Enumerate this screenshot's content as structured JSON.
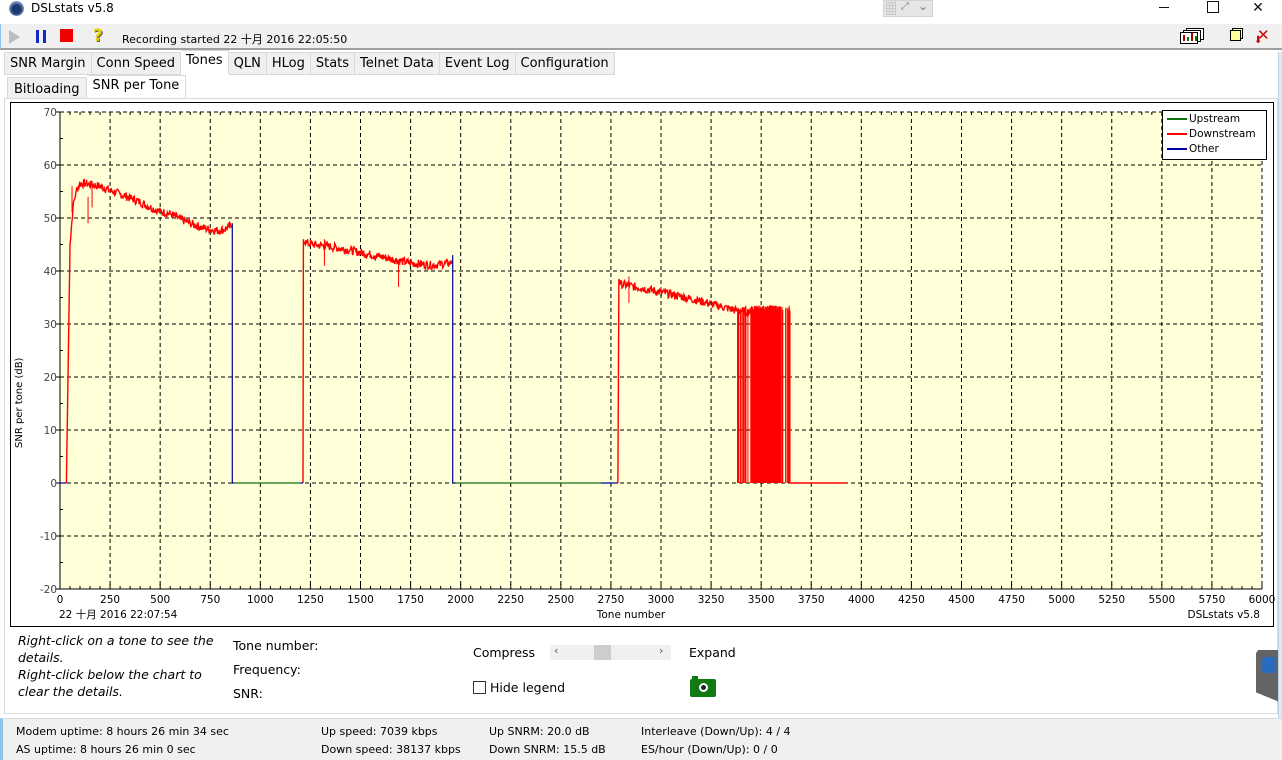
{
  "window": {
    "title": "DSLstats v5.8"
  },
  "toolbar": {
    "status": "Recording started 22 十月 2016 22:05:50",
    "icons": [
      "play-icon",
      "pause-icon",
      "stop-icon",
      "help-icon",
      "charts-icon",
      "sticky-note-icon",
      "close-download-icon"
    ]
  },
  "tabs": [
    "SNR Margin",
    "Conn Speed",
    "Tones",
    "QLN",
    "HLog",
    "Stats",
    "Telnet Data",
    "Event Log",
    "Configuration"
  ],
  "active_tab": "Tones",
  "subtabs": [
    "Bitloading",
    "SNR per Tone"
  ],
  "active_subtab": "SNR per Tone",
  "chart_footer": {
    "timestamp": "22 十月 2016 22:07:54",
    "watermark": "DSLstats v5.8"
  },
  "details": {
    "hint_1": "Right-click on a tone to see the details.",
    "hint_2": "Right-click below the chart to clear the details.",
    "tone_number_label": "Tone number:",
    "frequency_label": "Frequency:",
    "snr_label": "SNR:",
    "compress_label": "Compress",
    "expand_label": "Expand",
    "hide_legend_label": "Hide legend",
    "hide_legend_checked": false,
    "zoom_slider_position": 0.4
  },
  "status": {
    "modem_uptime": "Modem uptime:  8 hours 26 min 34 sec",
    "as_uptime": "AS uptime:  8 hours 26 min 0 sec",
    "up_speed": "Up speed: 7039 kbps",
    "down_speed": "Down speed: 38137 kbps",
    "up_snrm": "Up SNRM: 20.0 dB",
    "down_snrm": "Down SNRM: 15.5 dB",
    "interleave": "Interleave (Down/Up): 4 / 4",
    "es_hour": "ES/hour (Down/Up): 0 / 0"
  },
  "colors": {
    "upstream": "#107010",
    "downstream": "#ff0000",
    "other": "#0000a0",
    "plot_bg": "#ffffd8"
  },
  "chart_data": {
    "type": "line",
    "title": "",
    "xlabel": "Tone number",
    "ylabel": "SNR per tone (dB)",
    "xlim": [
      0,
      6000
    ],
    "ylim": [
      -20,
      70
    ],
    "x_ticks": [
      0,
      250,
      500,
      750,
      1000,
      1250,
      1500,
      1750,
      2000,
      2250,
      2500,
      2750,
      3000,
      3250,
      3500,
      3750,
      4000,
      4250,
      4500,
      4750,
      5000,
      5250,
      5500,
      5750,
      6000
    ],
    "y_ticks": [
      70,
      60,
      50,
      40,
      30,
      20,
      10,
      0,
      -10,
      -20
    ],
    "grid": true,
    "legend_position": "top-right",
    "series": [
      {
        "name": "Upstream",
        "color": "#107010",
        "segments": [
          {
            "x": [
              870,
              1200
            ],
            "y": [
              0,
              0
            ]
          },
          {
            "x": [
              1975,
              2700
            ],
            "y": [
              0,
              0
            ]
          }
        ]
      },
      {
        "name": "Downstream",
        "color": "#ff0000",
        "segments": [
          {
            "x": [
              32,
              40,
              50,
              65,
              80,
              100,
              130,
              160,
              200,
              250,
              300,
              350,
              400,
              450,
              500,
              550,
              600,
              650,
              700,
              750,
              800,
              857
            ],
            "y": [
              0,
              20,
              45,
              52,
              55,
              56.5,
              56.5,
              56.2,
              56,
              55.2,
              54.5,
              53.8,
              53,
              52,
              51.2,
              50.8,
              49.8,
              49,
              48.3,
              47.8,
              47.6,
              48.5
            ]
          },
          {
            "x": [
              1213,
              1215,
              1230,
              1280,
              1350,
              1450,
              1550,
              1650,
              1750,
              1850,
              1950,
              1957
            ],
            "y": [
              0,
              46,
              45.3,
              44.9,
              44.6,
              43.9,
              43.1,
              42.3,
              41.5,
              41.1,
              41.5,
              42
            ]
          },
          {
            "x": [
              2785,
              2790,
              2800,
              2900,
              3000,
              3100,
              3200,
              3300,
              3380,
              3450,
              3520,
              3580
            ],
            "y": [
              0,
              38.5,
              37.5,
              36.8,
              36,
              35.2,
              34.3,
              33.3,
              32.5,
              32.3,
              32.5,
              32.8
            ]
          },
          {
            "x": [
              3644,
              3925
            ],
            "y": [
              0,
              0
            ]
          }
        ],
        "dropouts": {
          "range": [
            3380,
            3644
          ],
          "from": 33,
          "to": 0
        },
        "spikes": [
          {
            "x": 60,
            "y": 51
          },
          {
            "x": 140,
            "y": 49
          },
          {
            "x": 160,
            "y": 52
          },
          {
            "x": 1320,
            "y": 41
          },
          {
            "x": 1690,
            "y": 37
          },
          {
            "x": 2840,
            "y": 34
          }
        ]
      },
      {
        "name": "Other",
        "color": "#0000a0",
        "segments": [
          {
            "x": [
              0,
              32
            ],
            "y": [
              0,
              0
            ]
          },
          {
            "x": [
              860,
              860,
              870
            ],
            "y": [
              49,
              0,
              0
            ]
          },
          {
            "x": [
              1200,
              1213
            ],
            "y": [
              0,
              0
            ]
          },
          {
            "x": [
              1960,
              1960,
              1975
            ],
            "y": [
              43,
              0,
              0
            ]
          },
          {
            "x": [
              2700,
              2785
            ],
            "y": [
              0,
              0
            ]
          }
        ]
      }
    ]
  }
}
